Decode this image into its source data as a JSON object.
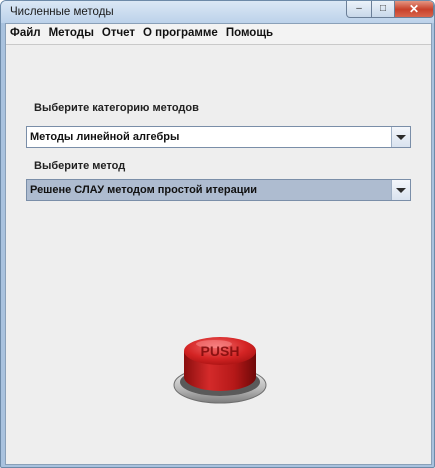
{
  "window": {
    "title": "Численные методы",
    "close_glyph": "✕",
    "min_glyph": "–",
    "max_glyph": "□"
  },
  "menu": [
    "Файл",
    "Методы",
    "Отчет",
    "О программе",
    "Помощь"
  ],
  "category": {
    "label": "Выберите категорию методов",
    "value": "Методы линейной алгебры"
  },
  "method": {
    "label": "Выберите метод",
    "value": "Решене СЛАУ методом простой итерации"
  },
  "push_button": {
    "text": "PUSH"
  },
  "colors": {
    "selected_combo": "#aebcd0",
    "button_red": "#c81f1f"
  }
}
